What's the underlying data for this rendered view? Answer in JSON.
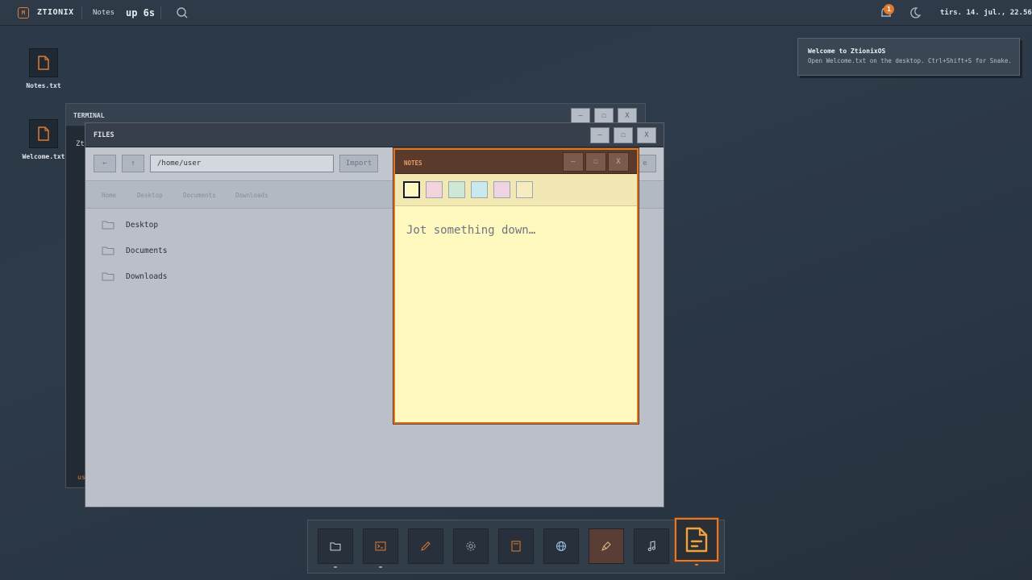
{
  "topbar": {
    "logo_icon": "ztionix-logo-icon",
    "brand": "ZTIONIX",
    "active_app": "Notes",
    "uptime": "up 6s",
    "notification_count": "1",
    "clock": "tirs. 14. jul., 22.56",
    "icons": [
      "search-icon",
      "bell-icon",
      "moon-icon"
    ]
  },
  "desktop": {
    "icons": [
      {
        "label": "Notes.txt",
        "icon": "file-icon"
      },
      {
        "label": "Welcome.txt",
        "icon": "file-icon"
      }
    ]
  },
  "toast": {
    "title": "Welcome to ZtionixOS",
    "body": "Open Welcome.txt on the desktop. Ctrl+Shift+S for Snake."
  },
  "terminal": {
    "title": "TERMINAL",
    "first_line": "Zt",
    "prompt": "us",
    "controls": {
      "minimize": "–",
      "maximize": "☐",
      "close": "X"
    }
  },
  "files": {
    "title": "FILES",
    "back": "←",
    "up": "↑",
    "path": "/home/user",
    "import": "Import",
    "new_folder_partial": "e",
    "quick_links": [
      "Home",
      "Desktop",
      "Documents",
      "Downloads"
    ],
    "folders": [
      "Desktop",
      "Documents",
      "Downloads"
    ],
    "controls": {
      "minimize": "–",
      "maximize": "☐",
      "close": "X"
    }
  },
  "notes": {
    "title": "NOTES",
    "placeholder": "Jot something down…",
    "swatch_colors": [
      "#fff8bf",
      "#f3d3dc",
      "#cfe8d5",
      "#c9e9ef",
      "#efd3e3",
      "#f6ecc0"
    ],
    "selected_swatch": 0,
    "controls": {
      "minimize": "–",
      "maximize": "☐",
      "close": "X"
    }
  },
  "dock": {
    "items": [
      {
        "name": "files",
        "icon": "folder-icon",
        "running": true
      },
      {
        "name": "terminal",
        "icon": "terminal-icon",
        "running": true
      },
      {
        "name": "editor",
        "icon": "pen-icon",
        "running": false
      },
      {
        "name": "settings",
        "icon": "gear-icon",
        "running": false
      },
      {
        "name": "calculator",
        "icon": "calculator-icon",
        "running": false
      },
      {
        "name": "browser",
        "icon": "globe-icon",
        "running": false
      },
      {
        "name": "paint",
        "icon": "brush-icon",
        "running": false
      },
      {
        "name": "music",
        "icon": "music-note-icon",
        "running": false
      },
      {
        "name": "notes",
        "icon": "notes-icon",
        "running": true
      }
    ],
    "accent": "#e07a30"
  }
}
